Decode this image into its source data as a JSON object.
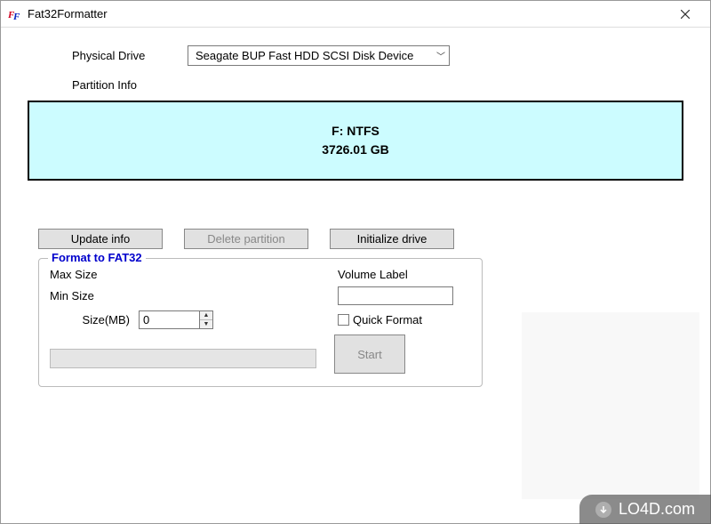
{
  "window": {
    "title": "Fat32Formatter"
  },
  "labels": {
    "physical_drive": "Physical Drive",
    "partition_info": "Partition Info"
  },
  "dropdown": {
    "selected": "Seagate BUP Fast HDD SCSI Disk Device"
  },
  "partition": {
    "name": "F: NTFS",
    "size": "3726.01 GB"
  },
  "buttons": {
    "update": "Update info",
    "delete": "Delete partition",
    "init": "Initialize drive",
    "start": "Start"
  },
  "groupbox": {
    "title": "Format to FAT32",
    "max_size_label": "Max Size",
    "max_size_value": "",
    "min_size_label": "Min Size",
    "min_size_value": "",
    "size_label": "Size(MB)",
    "size_value": "0",
    "volume_label": "Volume Label",
    "volume_value": "",
    "quick_format_label": "Quick Format"
  },
  "watermark": "LO4D.com"
}
